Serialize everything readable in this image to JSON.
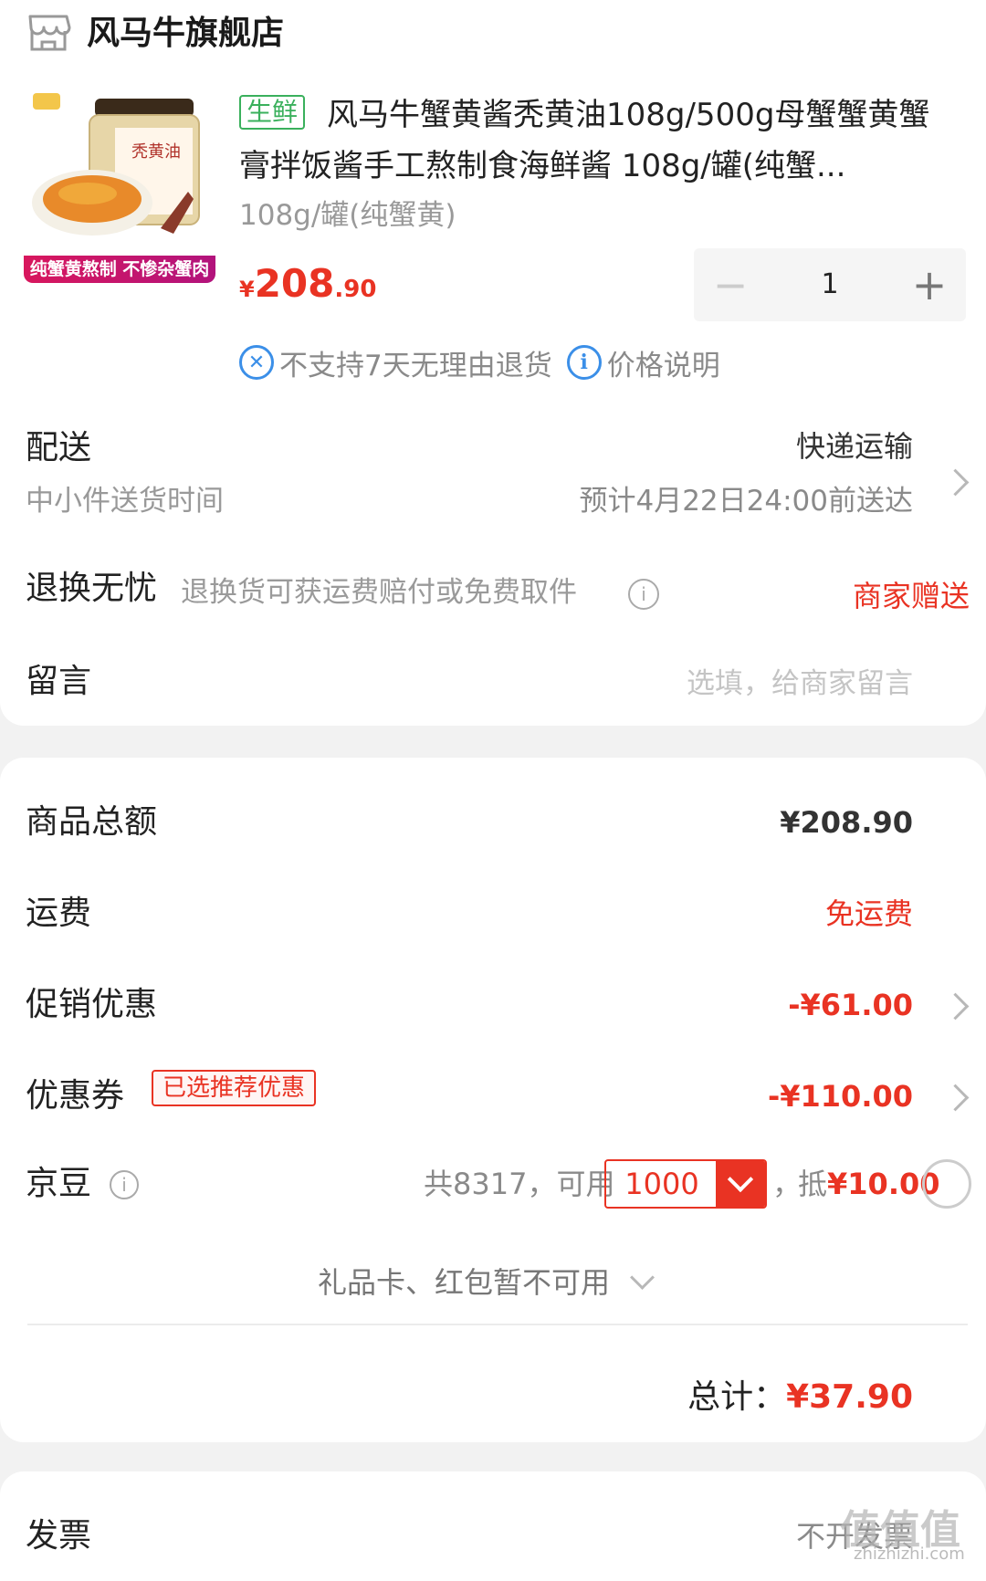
{
  "store": {
    "name": "风马牛旗舰店",
    "icon": "store-icon"
  },
  "product": {
    "image_banner": "纯蟹黄熬制 不惨杂蟹肉",
    "image_jar_label": "秃黄油",
    "tag": "生鲜",
    "title": "风马牛蟹黄酱秃黄油108g/500g母蟹蟹黄蟹膏拌饭酱手工熬制食海鲜酱 108g/罐(纯蟹...",
    "spec": "108g/罐(纯蟹黄)",
    "price_currency": "¥",
    "price_integer": "208",
    "price_decimal": ".90",
    "quantity": "1",
    "minus": "−",
    "plus": "+",
    "policy_no_return": "不支持7天无理由退货",
    "policy_price_note": "价格说明"
  },
  "delivery": {
    "label": "配送",
    "method": "快递运输",
    "time_label": "中小件送货时间",
    "time_value": "预计4月22日24:00前送达"
  },
  "returns": {
    "label": "退换无忧",
    "desc": "退换货可获运费赔付或免费取件",
    "value": "商家赠送"
  },
  "message": {
    "label": "留言",
    "placeholder": "选填，给商家留言"
  },
  "summary": {
    "goods_total_label": "商品总额",
    "goods_total_value": "¥208.90",
    "shipping_label": "运费",
    "shipping_value": "免运费",
    "promo_label": "促销优惠",
    "promo_value": "-¥61.00",
    "coupon_label": "优惠券",
    "coupon_tag": "已选推荐优惠",
    "coupon_value": "-¥110.00",
    "beans_label": "京豆",
    "beans_total": "共8317，可用",
    "beans_use": "1000",
    "beans_sep": "，",
    "beans_deduct_prefix": "抵",
    "beans_deduct_value": "¥10.00",
    "giftcard_text": "礼品卡、红包暂不可用",
    "total_label": "总计：",
    "total_value": "¥37.90"
  },
  "invoice": {
    "label": "发票",
    "value": "不开发票"
  },
  "watermark": {
    "text": "值值值",
    "sub": "zhizhizhi.com"
  },
  "colors": {
    "accent": "#e93323",
    "fresh": "#3ab05c",
    "info": "#3b8fe8"
  }
}
